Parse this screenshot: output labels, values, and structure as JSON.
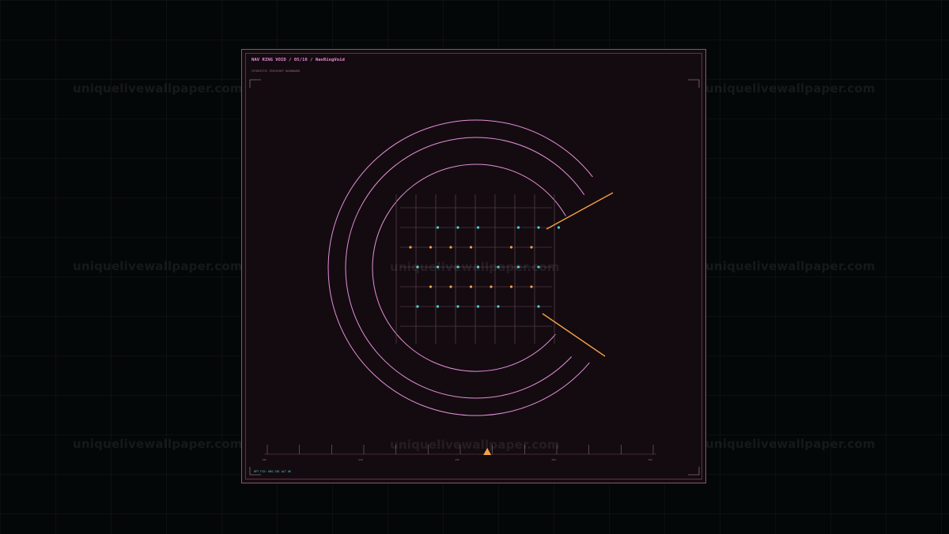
{
  "watermark": {
    "text": "uniquelivewallpaper.com"
  },
  "card": {
    "title": "NAV RING VOID / 05/10 / NavRingVoid",
    "subtitle": "FUTURISTIC SPACESHIP DASHBOARD",
    "status": "HPT FIX: HDG 281 ALT OK",
    "colors": {
      "ring": "#e290d8",
      "accent": "#f5a046",
      "dot_cyan": "#48d2d2",
      "dot_orange": "#f5a046",
      "grid": "#6b4a5a"
    }
  },
  "scale": {
    "labels": [
      "180",
      "220",
      "260",
      "300",
      "340"
    ],
    "indicator_fraction": 0.57
  },
  "dot_rows": [
    {
      "color": "cyan",
      "cols": [
        1,
        2,
        3,
        5,
        6,
        7
      ]
    },
    {
      "color": "orange",
      "cols": [
        0,
        1,
        2,
        3,
        5,
        6
      ]
    },
    {
      "color": "cyan",
      "cols": [
        0,
        1,
        2,
        3,
        4,
        5,
        6
      ]
    },
    {
      "color": "orange",
      "cols": [
        1,
        2,
        3,
        4,
        5,
        6
      ]
    },
    {
      "color": "cyan",
      "cols": [
        0,
        1,
        2,
        3,
        4,
        6
      ]
    }
  ]
}
